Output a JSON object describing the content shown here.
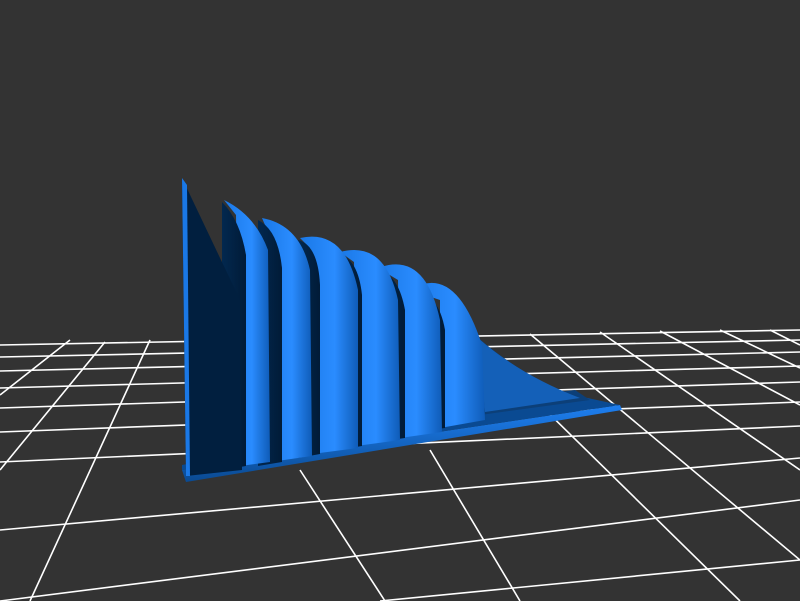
{
  "viewport": {
    "background_color": "#333333",
    "grid_color": "#ffffff",
    "model_color_light": "#1e7ff0",
    "model_color_mid": "#1466c8",
    "model_color_dark": "#022a52",
    "model_color_shadow": "#011a36"
  },
  "model": {
    "icon": "ribbed-triangular-wedge-model",
    "fin_count": 7
  }
}
